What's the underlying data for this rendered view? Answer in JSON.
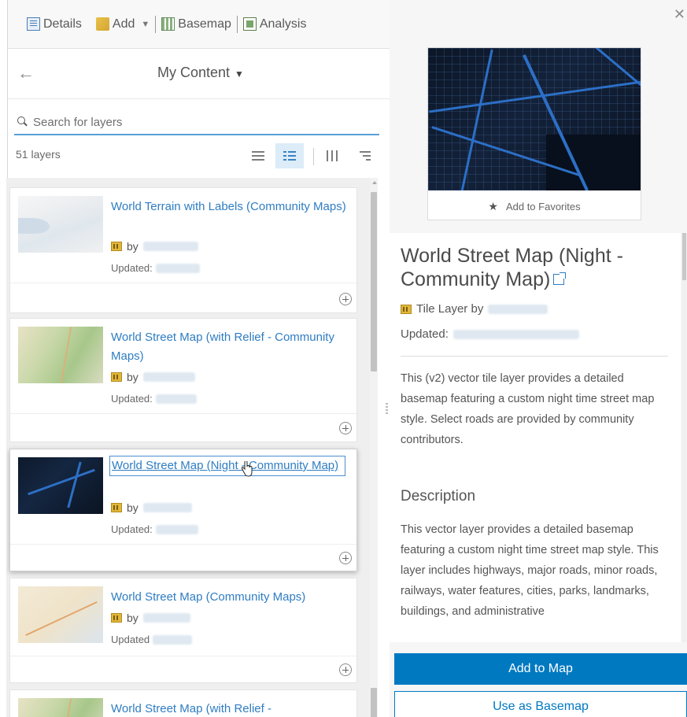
{
  "toolbar": {
    "details_label": "Details",
    "add_label": "Add",
    "basemap_label": "Basemap",
    "analysis_label": "Analysis"
  },
  "content": {
    "title": "My Content",
    "search_placeholder": "Search for layers",
    "layer_count": "51 layers"
  },
  "layers": [
    {
      "title": "World Terrain with Labels (Community Maps)",
      "by": "by",
      "updated": "Updated:"
    },
    {
      "title": "World Street Map (with Relief - Community Maps)",
      "by": "by",
      "updated": "Updated:"
    },
    {
      "title": "World Street Map (Night - Community Map)",
      "by": "by",
      "updated": "Updated:"
    },
    {
      "title": "World Street Map (Community Maps)",
      "by": "by",
      "updated": "Updated"
    },
    {
      "title": "World Street Map (with Relief -"
    }
  ],
  "details": {
    "favorites_label": "Add to Favorites",
    "title": "World Street Map (Night - Community Map)",
    "type_by": "Tile Layer by",
    "updated_label": "Updated:",
    "summary": "This (v2) vector tile layer provides a detailed basemap featuring a custom night time street map style. Select roads are provided by community contributors.",
    "description_heading": "Description",
    "description": "This vector layer provides a detailed basemap featuring a custom night time street map style. This layer includes highways, major roads, minor roads, railways, water features, cities, parks, landmarks, buildings, and administrative",
    "add_to_map": "Add to Map",
    "use_as_basemap": "Use as Basemap"
  },
  "colors": {
    "accent": "#0079c1",
    "link": "#2f7dc2"
  },
  "icons": {
    "close": "close-icon",
    "back": "arrow-left-icon",
    "search": "search-icon",
    "star": "star-icon",
    "add": "plus-circle-icon"
  }
}
